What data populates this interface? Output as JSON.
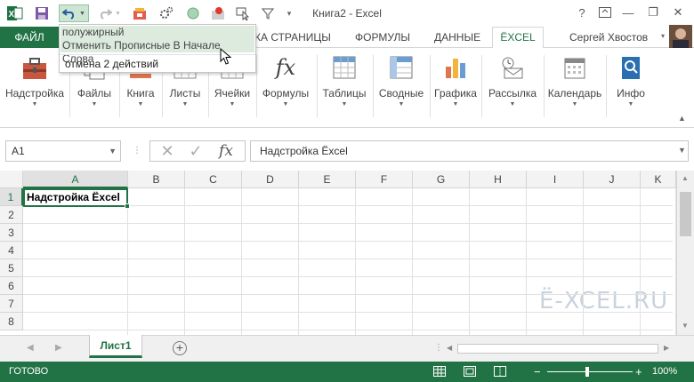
{
  "window": {
    "title": "Книга2 - Excel",
    "help_icon": "?",
    "minimize_icon": "—",
    "restore_icon": "❐",
    "close_icon": "✕"
  },
  "qat": {
    "icons": [
      "excel-logo-icon",
      "save-icon",
      "undo-icon",
      "redo-icon",
      "addin-icon",
      "macro-icon",
      "circle-icon",
      "record-icon",
      "cursor-icon",
      "funnel-icon",
      "customize-icon"
    ]
  },
  "undo_dropdown": {
    "items": [
      "полужирный",
      "Отменить Прописные В Начале Слова"
    ],
    "status": "отмена 2 действий"
  },
  "tabs": {
    "file": "ФАЙЛ",
    "items": [
      "КА СТРАНИЦЫ",
      "ФОРМУЛЫ",
      "ДАННЫЕ"
    ],
    "active": "ЁXCEL",
    "user": "Сергей Хвостов"
  },
  "ribbon": {
    "buttons": [
      {
        "label": "Надстройка",
        "icon": "toolbox-icon"
      },
      {
        "label": "Файлы",
        "icon": "files-icon"
      },
      {
        "label": "Книга",
        "icon": "book-icon"
      },
      {
        "label": "Листы",
        "icon": "sheets-icon"
      },
      {
        "label": "Ячейки",
        "icon": "cells-icon"
      },
      {
        "label": "Формулы",
        "icon": "fx-icon"
      },
      {
        "label": "Таблицы",
        "icon": "table-icon"
      },
      {
        "label": "Сводные",
        "icon": "pivot-icon"
      },
      {
        "label": "Графика",
        "icon": "chart-icon"
      },
      {
        "label": "Рассылка",
        "icon": "mail-icon"
      },
      {
        "label": "Календарь",
        "icon": "calendar-icon"
      },
      {
        "label": "Инфо",
        "icon": "info-icon"
      }
    ]
  },
  "formula_bar": {
    "name_box": "A1",
    "fx": "fx",
    "formula": "Надстройка Ёxcel"
  },
  "grid": {
    "columns": [
      "A",
      "B",
      "C",
      "D",
      "E",
      "F",
      "G",
      "H",
      "I",
      "J",
      "K"
    ],
    "rows": [
      "1",
      "2",
      "3",
      "4",
      "5",
      "6",
      "7",
      "8"
    ],
    "cell_a1": "Надстройка Ёxcel",
    "watermark": "Ё-XCEL.RU"
  },
  "sheets": {
    "tabs": [
      "Лист1"
    ],
    "add_icon": "+"
  },
  "status": {
    "ready": "ГОТОВО",
    "zoom": "100%",
    "zoom_minus": "−",
    "zoom_plus": "+"
  },
  "colors": {
    "accent": "#217346",
    "highlight": "#ddebdf"
  }
}
